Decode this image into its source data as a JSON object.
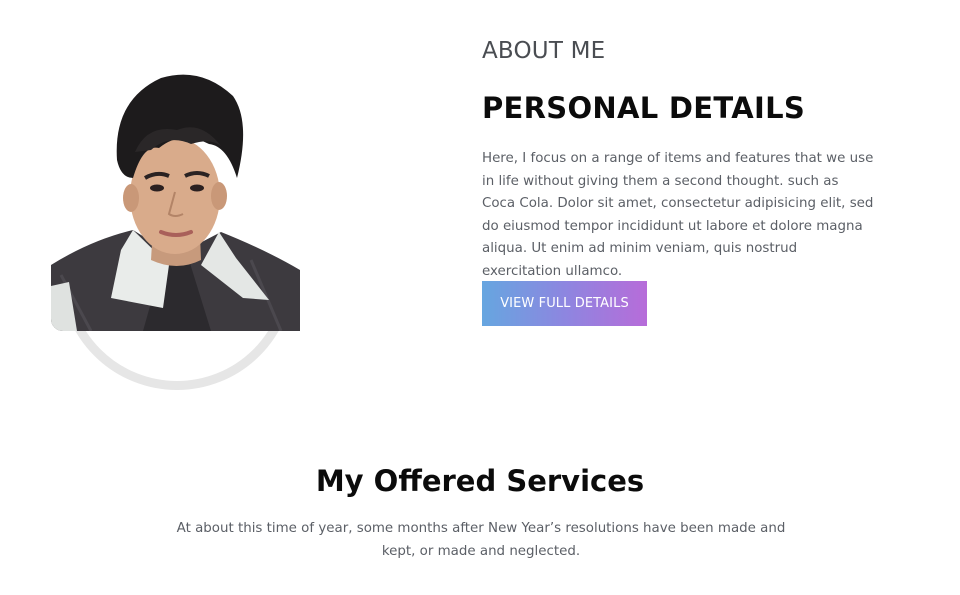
{
  "about": {
    "eyebrow": "ABOUT ME",
    "title": "PERSONAL DETAILS",
    "text": "Here, I focus on a range of items and features that we use in life without giving them a second thought. such as Coca Cola. Dolor sit amet, consectetur adipisicing elit, sed do eiusmod tempor incididunt ut labore et dolore magna aliqua. Ut enim ad minim veniam, quis nostrud exercitation ullamco.",
    "button_label": "VIEW FULL DETAILS",
    "button_gradient": [
      "#66a6e0",
      "#b76cd9"
    ]
  },
  "services": {
    "title": "My Offered Services",
    "text": "At about this time of year, some months after New Year’s resolutions have been made and kept, or made and neglected."
  },
  "colors": {
    "frame": "#e6e6e6",
    "body_text": "#5b5f66",
    "heading": "#0b0b0b",
    "eyebrow": "#4a4d52"
  }
}
